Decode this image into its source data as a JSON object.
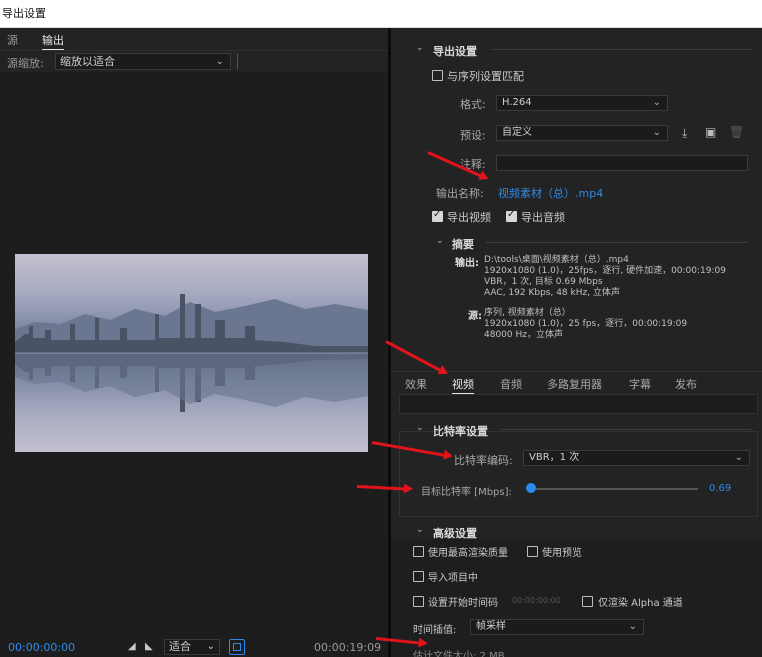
{
  "window": {
    "title": "导出设置"
  },
  "left": {
    "tabs": [
      "源",
      "输出"
    ],
    "active_tab": "输出",
    "source_scale": {
      "label": "源缩放:",
      "value": "缩放以适合"
    },
    "transport": {
      "timecode_in": "00:00:00:00",
      "fit_value": "适合",
      "timecode_out": "00:00:19:09"
    }
  },
  "export": {
    "section_title": "导出设置",
    "match_sequence": "与序列设置匹配",
    "format_label": "格式:",
    "format_value": "H.264",
    "preset_label": "预设:",
    "preset_value": "自定义",
    "comment_label": "注释:",
    "output_name_label": "输出名称:",
    "output_name_value": "视频素材（总）.mp4",
    "export_video": "导出视频",
    "export_audio": "导出音频",
    "summary_title": "摘要",
    "summary_output_key": "输出:",
    "summary_output_lines": [
      "D:\\tools\\桌面\\视频素材（总）.mp4",
      "1920x1080 (1.0)，25fps，逐行, 硬件加速，00:00:19:09",
      "VBR，1 次, 目标 0.69 Mbps",
      "AAC, 192 Kbps, 48  kHz, 立体声"
    ],
    "summary_source_key": "源:",
    "summary_source_lines": [
      "序列, 视频素材（总）",
      "1920x1080 (1.0)，25 fps，逐行，00:00:19:09",
      "48000 Hz，立体声"
    ]
  },
  "panel_tabs": [
    "效果",
    "视频",
    "音频",
    "多路复用器",
    "字幕",
    "发布"
  ],
  "active_panel_tab": "视频",
  "bitrate": {
    "section_title": "比特率设置",
    "encoding_label": "比特率编码:",
    "encoding_value": "VBR，1 次",
    "target_label": "目标比特率 [Mbps]:",
    "target_value": "0.69",
    "target_fraction": 0.02
  },
  "advanced": {
    "section_title": "高级设置",
    "max_render_quality": "使用最高渲染质量",
    "use_previews": "使用预览",
    "import_into_project": "导入项目中",
    "set_start_timecode": "设置开始时间码",
    "start_timecode_value": "00:00:00:00",
    "render_alpha_only": "仅渲染 Alpha 通道",
    "time_interpolation_label": "时间插值:",
    "time_interpolation_value": "帧采样",
    "estimated_size_partial": "估计文件大小: 2 MB"
  },
  "colors": {
    "accent": "#2d8ceb",
    "annotation_arrow": "#e0141a",
    "panel_bg": "#232323"
  }
}
